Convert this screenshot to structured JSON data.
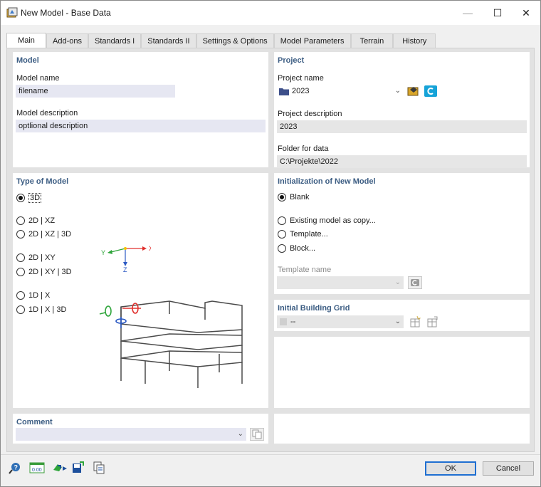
{
  "window": {
    "title": "New Model - Base Data",
    "controls": {
      "minimize": "—",
      "maximize": "☐",
      "close": "✕"
    }
  },
  "tabs": [
    {
      "label": "Main",
      "active": true
    },
    {
      "label": "Add-ons"
    },
    {
      "label": "Standards I"
    },
    {
      "label": "Standards II"
    },
    {
      "label": "Settings & Options"
    },
    {
      "label": "Model Parameters"
    },
    {
      "label": "Terrain"
    },
    {
      "label": "History"
    }
  ],
  "model": {
    "section_title": "Model",
    "name_label": "Model name",
    "name_value": "filename",
    "description_label": "Model description",
    "description_value": "optlional description"
  },
  "project": {
    "section_title": "Project",
    "name_label": "Project name",
    "name_value": "2023",
    "description_label": "Project description",
    "description_value": "2023",
    "folder_label": "Folder for data",
    "folder_value": "C:\\Projekte\\2022"
  },
  "model_type": {
    "section_title": "Type of Model",
    "options": [
      "3D",
      "2D | XZ",
      "2D | XZ | 3D",
      "2D | XY",
      "2D | XY | 3D",
      "1D | X",
      "1D | X | 3D"
    ],
    "selected": "3D",
    "axes": {
      "x": "X",
      "y": "Y",
      "z": "Z"
    }
  },
  "initialization": {
    "section_title": "Initialization of New Model",
    "options": [
      "Blank",
      "Existing model as copy...",
      "Template...",
      "Block..."
    ],
    "selected": "Blank",
    "template_label": "Template name",
    "template_value": ""
  },
  "building_grid": {
    "section_title": "Initial Building Grid",
    "value": "--"
  },
  "comment": {
    "section_title": "Comment",
    "value": ""
  },
  "footer": {
    "ok_label": "OK",
    "cancel_label": "Cancel",
    "units_badge": "0.00"
  },
  "colors": {
    "section_title": "#3c5d83",
    "field_blue": "#e6e7f2",
    "field_grey": "#e6e6e6",
    "accent": "#1f6fd1"
  }
}
